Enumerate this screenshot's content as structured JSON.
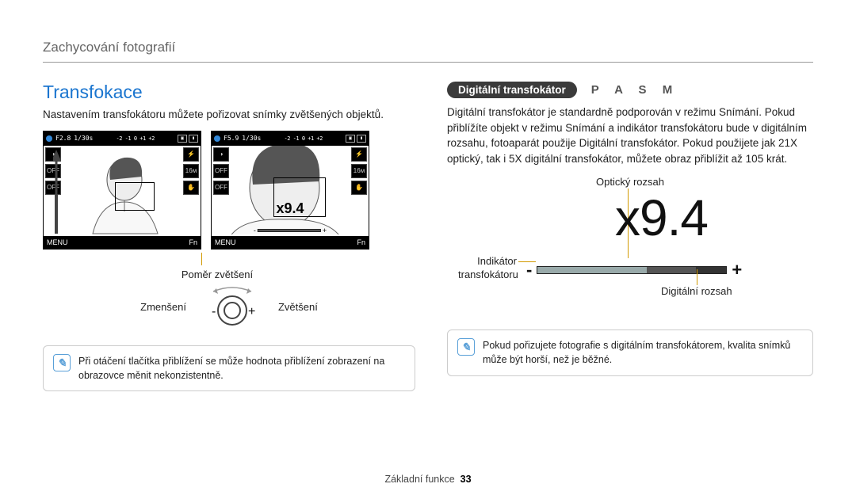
{
  "header": {
    "breadcrumb": "Zachycování fotografií"
  },
  "left": {
    "title": "Transfokace",
    "intro": "Nastavením transfokátoru můžete pořizovat snímky zvětšených objektů.",
    "screen1": {
      "aperture": "F2.8",
      "shutter": "1/30s",
      "menu": "MENU",
      "fn": "Fn"
    },
    "screen2": {
      "aperture": "F5.9",
      "shutter": "1/30s",
      "menu": "MENU",
      "fn": "Fn",
      "zoom_overlay": "x9.4"
    },
    "caption_ratio": "Poměr zvětšení",
    "dial": {
      "out_label": "Zmenšení",
      "in_label": "Zvětšení",
      "minus": "-",
      "plus": "+"
    },
    "note": "Při otáčení tlačítka přiblížení se může hodnota přiblížení zobrazení na obrazovce měnit nekonzistentně."
  },
  "right": {
    "pill": "Digitální transfokátor",
    "modes": "P A S M",
    "para": "Digitální transfokátor je standardně podporován v režimu Snímání. Pokud přiblížíte objekt v režimu Snímání a indikátor transfokátoru bude v digitálním rozsahu, fotoaparát použije Digitální transfokátor. Pokud použijete jak 21X optický, tak i 5X digitální transfokátor, můžete obraz přiblížit až 105 krát.",
    "diagram": {
      "optical_label": "Optický rozsah",
      "digital_label": "Digitální rozsah",
      "indicator_label_l1": "Indikátor",
      "indicator_label_l2": "transfokátoru",
      "zoom_big": "x9.4",
      "minus": "-",
      "plus": "+"
    },
    "note": "Pokud pořizujete fotografie s digitálním transfokátorem, kvalita snímků může být horší, než je běžné."
  },
  "footer": {
    "section": "Základní funkce",
    "page": "33"
  }
}
